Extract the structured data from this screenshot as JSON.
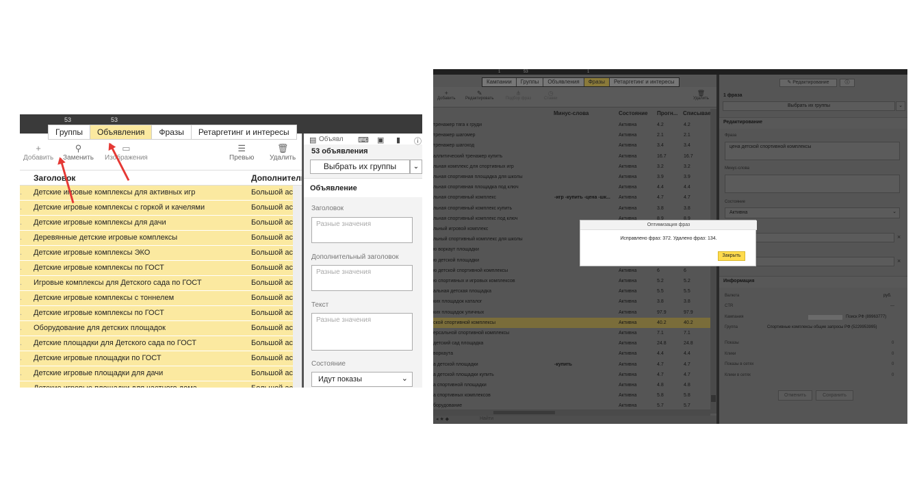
{
  "left": {
    "tab_counts": [
      "53",
      "53"
    ],
    "tabs": [
      "Группы",
      "Объявления",
      "Фразы",
      "Ретаргетинг и интересы"
    ],
    "toolbar": {
      "add": "Добавить",
      "replace": "Заменить",
      "images": "Изображения",
      "preview": "Превью",
      "delete": "Удалить"
    },
    "columns": {
      "title": "Заголовок",
      "extra": "Дополнительн"
    },
    "rows": [
      {
        "title": "Детские игровые комплексы для активных игр",
        "extra": "Большой асс"
      },
      {
        "title": "Детские игровые комплексы с горкой и качелями",
        "extra": "Большой асс"
      },
      {
        "title": "Детские игровые комплексы для дачи",
        "extra": "Большой асс"
      },
      {
        "title": "Деревянные детские игровые комплексы",
        "extra": "Большой асс"
      },
      {
        "title": "Детские игровые комплексы ЭКО",
        "extra": "Большой асс"
      },
      {
        "title": "Детские игровые комплексы по ГОСТ",
        "extra": "Большой асс"
      },
      {
        "title": "Игровые комплексы для Детского сада по ГОСТ",
        "extra": "Большой асс"
      },
      {
        "title": "Детские игровые комплексы с тоннелем",
        "extra": "Большой асс"
      },
      {
        "title": "Детские игровые комплексы по ГОСТ",
        "extra": "Большой асс"
      },
      {
        "title": "Оборудование для детских площадок",
        "extra": "Большой асс"
      },
      {
        "title": "Детские площадки для Детского сада по ГОСТ",
        "extra": "Большой асс"
      },
      {
        "title": "Детские игровые площадки по ГОСТ",
        "extra": "Большой асс"
      },
      {
        "title": "Детские игровые площадки для дачи",
        "extra": "Большой асс"
      },
      {
        "title": "Детские игровые площадки для частного дома",
        "extra": "Большой асс"
      }
    ],
    "panel": {
      "tab_label": "Объявл",
      "count_title": "53 объявления",
      "select_groups": "Выбрать их группы",
      "section": "Объявление",
      "f_title": "Заголовок",
      "f_extra": "Дополнительный заголовок",
      "f_text": "Текст",
      "placeholder": "Разные значения",
      "f_state": "Состояние",
      "state_value": "Идут показы"
    }
  },
  "right": {
    "tab_counts": [
      "1",
      "53",
      "1"
    ],
    "tabs": [
      "Кампании",
      "Группы",
      "Объявления",
      "Фразы",
      "Ретаргетинг и интересы"
    ],
    "toolbar": {
      "add": "Добавить",
      "edit": "Редактировать",
      "phrase": "Подбор фраз",
      "stats": "Ставки",
      "delete": "Удалить"
    },
    "columns": {
      "minus": "Минус-слова",
      "state": "Состояние",
      "forecast": "Прогн...",
      "spend": "Списываема"
    },
    "rows": [
      {
        "phrase": "тренажер тяга к груди",
        "minus": "",
        "state": "Активна",
        "a": "4.2",
        "b": "4.2"
      },
      {
        "phrase": "тренажер шагомер",
        "minus": "",
        "state": "Активна",
        "a": "2.1",
        "b": "2.1"
      },
      {
        "phrase": "тренажер шагоход",
        "minus": "",
        "state": "Активна",
        "a": "3.4",
        "b": "3.4"
      },
      {
        "phrase": "аллитический тренажер купить",
        "minus": "",
        "state": "Активна",
        "a": "16.7",
        "b": "16.7"
      },
      {
        "phrase": "льная комплекс для спортивных игр",
        "minus": "",
        "state": "Активна",
        "a": "3.2",
        "b": "3.2"
      },
      {
        "phrase": "льная спортивная площадка для школы",
        "minus": "",
        "state": "Активна",
        "a": "3.9",
        "b": "3.9"
      },
      {
        "phrase": "льная спортивная площадка под ключ",
        "minus": "",
        "state": "Активна",
        "a": "4.4",
        "b": "4.4"
      },
      {
        "phrase": "льная спортивный комплекс",
        "minus": "-игр -купить -цена -шк...",
        "state": "Активна",
        "a": "4.7",
        "b": "4.7"
      },
      {
        "phrase": "льная спортивный комплекс купить",
        "minus": "",
        "state": "Активна",
        "a": "3.8",
        "b": "3.8"
      },
      {
        "phrase": "льная спортивный комплекс под ключ",
        "minus": "",
        "state": "Активна",
        "a": "8.9",
        "b": "8.9"
      },
      {
        "phrase": "льный игровой комплекс",
        "minus": "",
        "state": "",
        "a": "",
        "b": ""
      },
      {
        "phrase": "льный спортивный комплекс для школы",
        "minus": "",
        "state": "",
        "a": "",
        "b": ""
      },
      {
        "phrase": "ю воркаут площадки",
        "minus": "",
        "state": "",
        "a": "",
        "b": ""
      },
      {
        "phrase": "ю детской площадки",
        "minus": "",
        "state": "",
        "a": "",
        "b": ""
      },
      {
        "phrase": "ю детской спортивной комплексы",
        "minus": "",
        "state": "Активна",
        "a": "6",
        "b": "6"
      },
      {
        "phrase": "ю спортивных и игровых комплексов",
        "minus": "",
        "state": "Активна",
        "a": "5.2",
        "b": "5.2"
      },
      {
        "phrase": "альная детская площадка",
        "minus": "",
        "state": "Активна",
        "a": "5.5",
        "b": "5.5"
      },
      {
        "phrase": "ких площадок каталог",
        "minus": "",
        "state": "Активна",
        "a": "3.8",
        "b": "3.8"
      },
      {
        "phrase": "ких площадок уличных",
        "minus": "",
        "state": "Активна",
        "a": "97.9",
        "b": "97.9"
      },
      {
        "phrase": "ской спортивной комплексы",
        "minus": "",
        "state": "Активна",
        "a": "40.2",
        "b": "40.2",
        "hl": true
      },
      {
        "phrase": "ерсальной спортивной комплексы",
        "minus": "",
        "state": "Активна",
        "a": "7.1",
        "b": "7.1"
      },
      {
        "phrase": "детский сад площадка",
        "minus": "",
        "state": "Активна",
        "a": "24.8",
        "b": "24.8"
      },
      {
        "phrase": "воркаута",
        "minus": "",
        "state": "Активна",
        "a": "4.4",
        "b": "4.4"
      },
      {
        "phrase": "а детской площадки",
        "minus": "-купить",
        "state": "Активна",
        "a": "4.7",
        "b": "4.7"
      },
      {
        "phrase": "а детской площадки купить",
        "minus": "",
        "state": "Активна",
        "a": "4.7",
        "b": "4.7"
      },
      {
        "phrase": "а спортивной площадки",
        "minus": "",
        "state": "Активна",
        "a": "4.8",
        "b": "4.8"
      },
      {
        "phrase": "а спортивных комплексов",
        "minus": "",
        "state": "Активна",
        "a": "5.8",
        "b": "5.8"
      },
      {
        "phrase": "борудование",
        "minus": "",
        "state": "Активна",
        "a": "5.7",
        "b": "5.7"
      }
    ],
    "footer": {
      "find": "Найти"
    },
    "panel": {
      "edit_tab": "Редактирование",
      "count": "1 фраза",
      "select_groups": "Выбрать их группы",
      "section_edit": "Редактирование",
      "phrase_label": "Фраза",
      "phrase_value": "цена детской спортивной комплексы",
      "minus_label": "Минус-слова",
      "state_label": "Состояние",
      "state_value": "Активна",
      "section_info": "Информация",
      "currency_label": "Валюта",
      "currency_value": "руб.",
      "ctr_label": "CTR",
      "ctr_value": "—",
      "campaign_label": "Кампания",
      "campaign_value": "Поиск РФ (89963777)",
      "group_label": "Группа",
      "group_value": "Спортивные комплексы общие запросы РФ (5229953995)",
      "shows_label": "Показы",
      "shows_value": "0",
      "clicks_label": "Клики",
      "clicks_value": "0",
      "net_shows_label": "Показы в сетях",
      "net_shows_value": "0",
      "net_clicks_label": "Клики в сетях",
      "net_clicks_value": "0",
      "cancel": "Отменить",
      "save": "Сохранить"
    },
    "dialog": {
      "title": "Оптимизация фраз",
      "message": "Исправлено фраз: 372. Удалено фраз: 134.",
      "close": "Закрыть"
    }
  }
}
